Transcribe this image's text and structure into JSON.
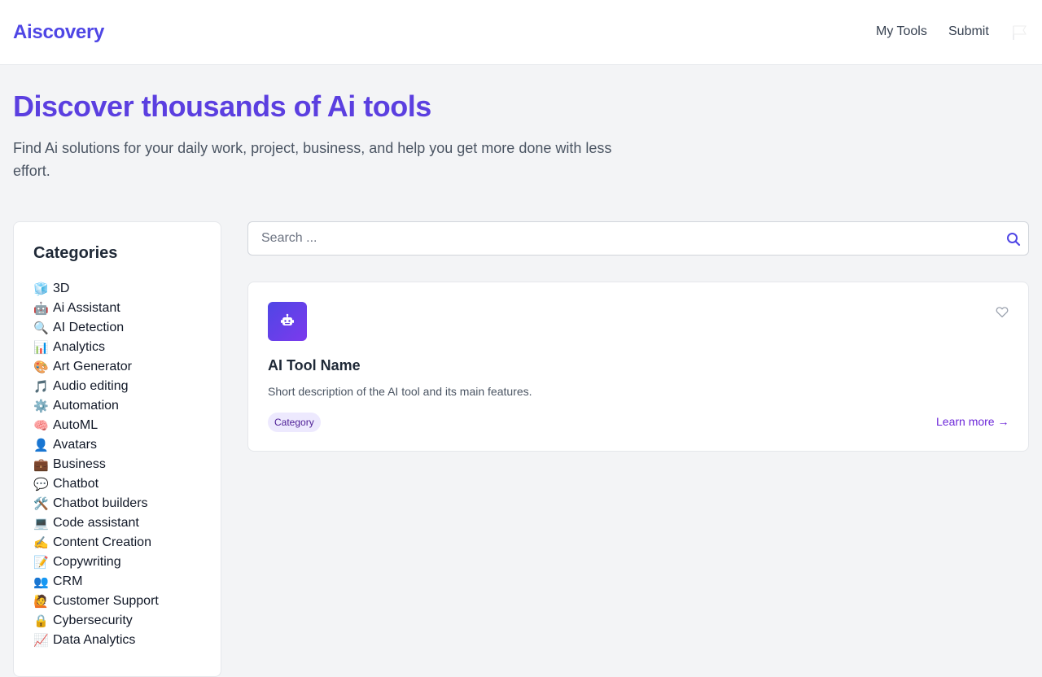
{
  "header": {
    "logo": "Aiscovery",
    "nav": [
      {
        "label": "My Tools"
      },
      {
        "label": "Submit"
      }
    ],
    "icon": "flag-icon"
  },
  "hero": {
    "title": "Discover thousands of Ai tools",
    "subtitle": "Find Ai solutions for your daily work, project, business, and help you get more done with less effort."
  },
  "sidebar": {
    "title": "Categories",
    "items": [
      {
        "emoji": "🧊",
        "label": "3D"
      },
      {
        "emoji": "🤖",
        "label": "Ai Assistant"
      },
      {
        "emoji": "🔍",
        "label": "AI Detection"
      },
      {
        "emoji": "📊",
        "label": "Analytics"
      },
      {
        "emoji": "🎨",
        "label": "Art Generator"
      },
      {
        "emoji": "🎵",
        "label": "Audio editing"
      },
      {
        "emoji": "⚙️",
        "label": "Automation"
      },
      {
        "emoji": "🧠",
        "label": "AutoML"
      },
      {
        "emoji": "👤",
        "label": "Avatars"
      },
      {
        "emoji": "💼",
        "label": "Business"
      },
      {
        "emoji": "💬",
        "label": "Chatbot"
      },
      {
        "emoji": "🛠️",
        "label": "Chatbot builders"
      },
      {
        "emoji": "💻",
        "label": "Code assistant"
      },
      {
        "emoji": "✍️",
        "label": "Content Creation"
      },
      {
        "emoji": "📝",
        "label": "Copywriting"
      },
      {
        "emoji": "👥",
        "label": "CRM"
      },
      {
        "emoji": "🙋",
        "label": "Customer Support"
      },
      {
        "emoji": "🔒",
        "label": "Cybersecurity"
      },
      {
        "emoji": "📈",
        "label": "Data Analytics"
      }
    ]
  },
  "search": {
    "placeholder": "Search ...",
    "value": "",
    "icon": "search-icon"
  },
  "card": {
    "icon": "robot-icon",
    "name": "AI Tool Name",
    "description": "Short description of the AI tool and its main features.",
    "category": "Category",
    "link": "Learn more →",
    "favorite_icon": "heart-icon"
  },
  "colors": {
    "brand": "#4f46e5",
    "hero_title": "#5b3fe0",
    "link": "#6d28d9",
    "badge_bg": "#ede9fe",
    "page_bg": "#f3f4f6"
  }
}
